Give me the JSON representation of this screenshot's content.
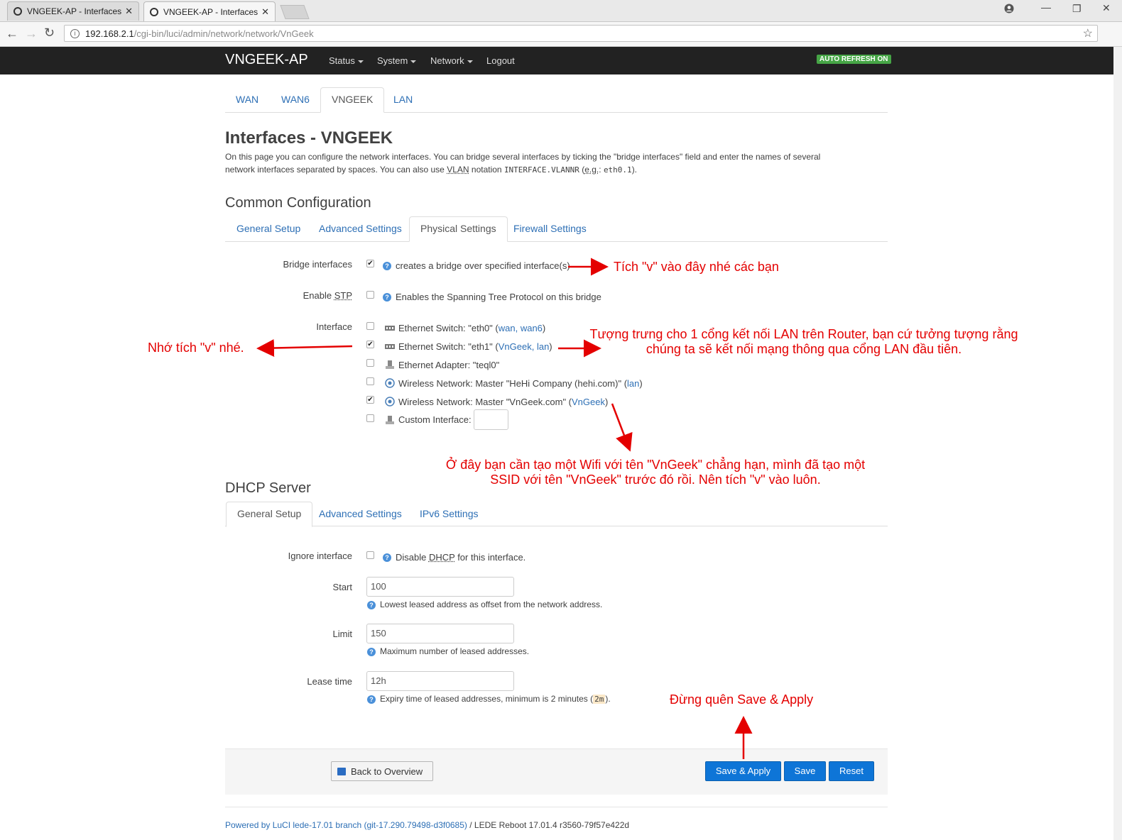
{
  "browser": {
    "tabs": [
      {
        "title": "VNGEEK-AP - Interfaces -",
        "active": false
      },
      {
        "title": "VNGEEK-AP - Interfaces -",
        "active": true
      }
    ],
    "url_host": "192.168.2.1",
    "url_path": "/cgi-bin/luci/admin/network/network/VnGeek",
    "close_glyph": "✕"
  },
  "header": {
    "brand": "VNGEEK-AP",
    "nav": [
      "Status",
      "System",
      "Network",
      "Logout"
    ],
    "auto_refresh": "AUTO REFRESH ON"
  },
  "iface_tabs": [
    "WAN",
    "WAN6",
    "VNGEEK",
    "LAN"
  ],
  "page": {
    "title": "Interfaces - VNGEEK",
    "desc_1": "On this page you can configure the network interfaces. You can bridge several interfaces by ticking the \"bridge interfaces\" field and enter the names of several",
    "desc_2a": "network interfaces separated by spaces. You can also use ",
    "desc_vlan": "VLAN",
    "desc_2b": " notation ",
    "desc_code": "INTERFACE.VLANNR",
    "desc_2c": " (",
    "desc_eg": "e.g.",
    "desc_2d": ": ",
    "desc_code2": "eth0.1",
    "desc_2e": ")."
  },
  "common": {
    "heading": "Common Configuration",
    "tabs": [
      "General Setup",
      "Advanced Settings",
      "Physical Settings",
      "Firewall Settings"
    ],
    "bridge_label": "Bridge interfaces",
    "bridge_help": "creates a bridge over specified interface(s)",
    "stp_label_a": "Enable ",
    "stp_label_b": "STP",
    "stp_help": "Enables the Spanning Tree Protocol on this bridge",
    "iface_label": "Interface",
    "interfaces": [
      {
        "text": "Ethernet Switch: \"eth0\" (",
        "links": "wan, wan6",
        "close": ")",
        "checked": false
      },
      {
        "text": "Ethernet Switch: \"eth1\" (",
        "links": "VnGeek, lan",
        "close": ")",
        "checked": true
      },
      {
        "text": "Ethernet Adapter: \"teql0\"",
        "links": "",
        "close": "",
        "checked": false
      },
      {
        "text": "Wireless Network: Master \"HeHi Company (hehi.com)\" (",
        "links": "lan",
        "close": ")",
        "checked": false
      },
      {
        "text": "Wireless Network: Master \"VnGeek.com\" (",
        "links": "VnGeek",
        "close": ")",
        "checked": true
      },
      {
        "text": "Custom Interface:",
        "links": "",
        "close": "",
        "checked": false
      }
    ]
  },
  "dhcp": {
    "heading": "DHCP Server",
    "tabs": [
      "General Setup",
      "Advanced Settings",
      "IPv6 Settings"
    ],
    "ignore_label": "Ignore interface",
    "ignore_help_a": "Disable ",
    "ignore_help_b": "DHCP",
    "ignore_help_c": " for this interface.",
    "start_label": "Start",
    "start_value": "100",
    "start_help": "Lowest leased address as offset from the network address.",
    "limit_label": "Limit",
    "limit_value": "150",
    "limit_help": "Maximum number of leased addresses.",
    "lease_label": "Lease time",
    "lease_value": "12h",
    "lease_help_a": "Expiry time of leased addresses, minimum is 2 minutes (",
    "lease_help_code": "2m",
    "lease_help_b": ")."
  },
  "actions": {
    "back": "Back to Overview",
    "save_apply": "Save & Apply",
    "save": "Save",
    "reset": "Reset"
  },
  "footer": {
    "link": "Powered by LuCI lede-17.01 branch (git-17.290.79498-d3f0685)",
    "rest": " / LEDE Reboot 17.01.4 r3560-79f57e422d"
  },
  "annotations": {
    "bridge": "Tích \"v\" vào đây nhé các bạn",
    "eth1_left": "Nhớ tích \"v\" nhé.",
    "eth1_right_1": "Tượng trưng cho 1 cổng kết nối LAN trên Router, bạn cứ tưởng tượng rằng",
    "eth1_right_2": "chúng ta sẽ kết nối mạng thông qua cổng LAN đầu tiên.",
    "wifi_1": "Ở đây bạn cần tạo một Wifi với tên \"VnGeek\" chẳng hạn, mình đã tạo một",
    "wifi_2": "SSID với tên \"VnGeek\" trước đó rồi. Nên tích \"v\" vào luôn.",
    "save": "Đừng quên Save & Apply"
  },
  "colors": {
    "accent": "#2d6fb5",
    "button": "#0e75d7",
    "annotation": "#e40000",
    "header": "#222222"
  }
}
